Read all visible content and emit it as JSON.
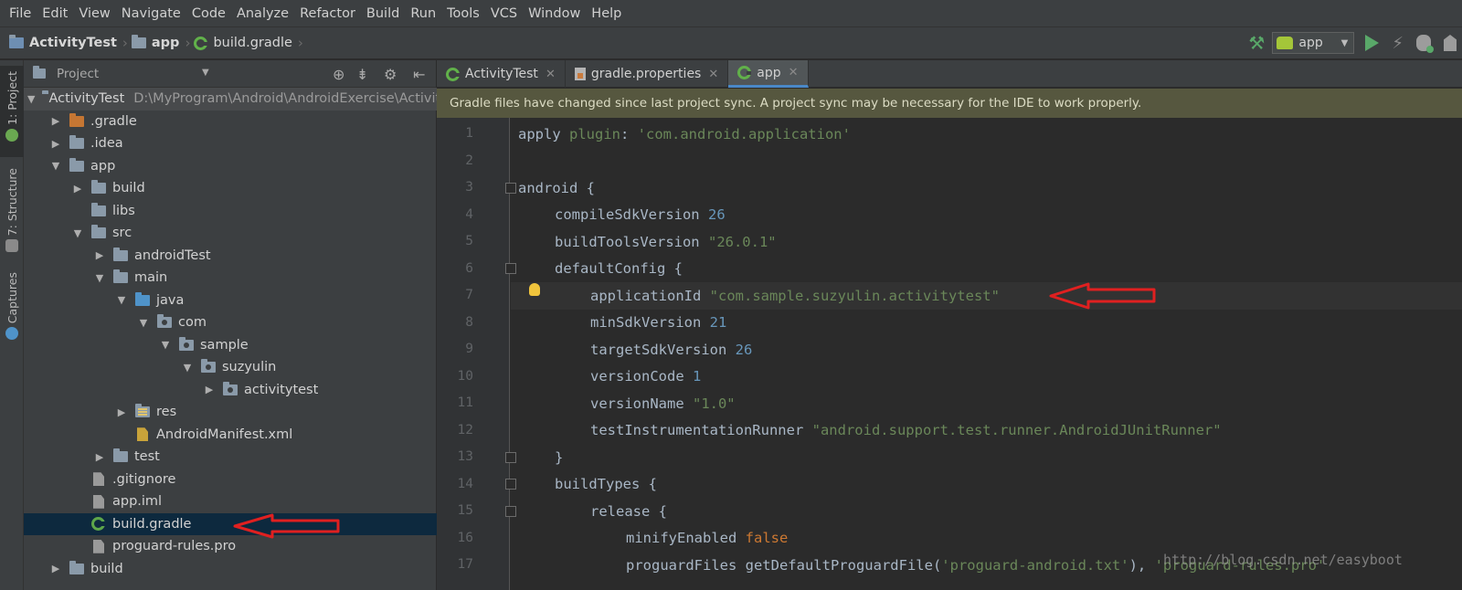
{
  "menu": [
    "File",
    "Edit",
    "View",
    "Navigate",
    "Code",
    "Analyze",
    "Refactor",
    "Build",
    "Run",
    "Tools",
    "VCS",
    "Window",
    "Help"
  ],
  "breadcrumb": {
    "project": "ActivityTest",
    "module": "app",
    "file": "build.gradle"
  },
  "run_config": "app",
  "tool_strip": {
    "project_tab": "1: Project",
    "structure_tab": "7: Structure",
    "captures_tab": "Captures"
  },
  "project_panel": {
    "title": "Project",
    "root_name": "ActivityTest",
    "root_path": "D:\\MyProgram\\Android\\AndroidExercise\\Activity",
    "tree": [
      {
        "label": ".gradle"
      },
      {
        "label": ".idea"
      },
      {
        "label": "app"
      },
      {
        "label": "build"
      },
      {
        "label": "libs"
      },
      {
        "label": "src"
      },
      {
        "label": "androidTest"
      },
      {
        "label": "main"
      },
      {
        "label": "java"
      },
      {
        "label": "com"
      },
      {
        "label": "sample"
      },
      {
        "label": "suzyulin"
      },
      {
        "label": "activitytest"
      },
      {
        "label": "res"
      },
      {
        "label": "AndroidManifest.xml"
      },
      {
        "label": "test"
      },
      {
        "label": ".gitignore"
      },
      {
        "label": "app.iml"
      },
      {
        "label": "build.gradle"
      },
      {
        "label": "proguard-rules.pro"
      },
      {
        "label": "build"
      }
    ]
  },
  "tabs": [
    "ActivityTest",
    "gradle.properties",
    "app"
  ],
  "notification": "Gradle files have changed since last project sync. A project sync may be necessary for the IDE to work properly.",
  "line_numbers": [
    "1",
    "2",
    "3",
    "4",
    "5",
    "6",
    "7",
    "8",
    "9",
    "10",
    "11",
    "12",
    "13",
    "14",
    "15",
    "16",
    "17"
  ],
  "code": {
    "l1a": "apply ",
    "l1b": "plugin",
    "l1c": ": ",
    "l1d": "'com.android.application'",
    "l3": "android {",
    "l4a": "compileSdkVersion ",
    "l4b": "26",
    "l5a": "buildToolsVersion ",
    "l5b": "\"26.0.1\"",
    "l6": "defaultConfig {",
    "l7a": "applicationId ",
    "l7b": "\"com.sample.suzyulin.activitytest\"",
    "l8a": "minSdkVersion ",
    "l8b": "21",
    "l9a": "targetSdkVersion ",
    "l9b": "26",
    "l10a": "versionCode ",
    "l10b": "1",
    "l11a": "versionName ",
    "l11b": "\"1.0\"",
    "l12a": "testInstrumentationRunner ",
    "l12b": "\"android.support.test.runner.AndroidJUnitRunner\"",
    "l13": "}",
    "l14": "buildTypes {",
    "l15": "release {",
    "l16a": "minifyEnabled ",
    "l16b": "false",
    "l17a": "proguardFiles getDefaultProguardFile(",
    "l17b": "'proguard-android.txt'",
    "l17c": "), ",
    "l17d": "'proguard-rules.pro'"
  },
  "watermark": "http://blog.csdn.net/easyboot",
  "colors": {
    "annotation_arrow": "#e02020",
    "accent": "#4a88c7",
    "string": "#6a8759",
    "number": "#6897bb",
    "keyword": "#cc7832"
  }
}
